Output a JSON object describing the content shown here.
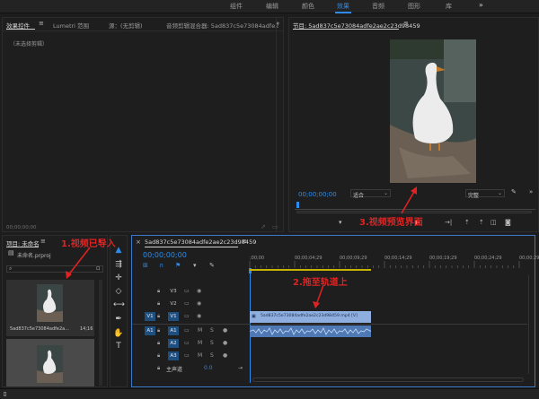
{
  "workspace_tabs": [
    {
      "label": "组件",
      "active": false
    },
    {
      "label": "编辑",
      "active": false
    },
    {
      "label": "颜色",
      "active": false
    },
    {
      "label": "效果",
      "active": true
    },
    {
      "label": "音频",
      "active": false
    },
    {
      "label": "图形",
      "active": false
    },
    {
      "label": "库",
      "active": false
    }
  ],
  "workspace_more": "»",
  "effects_panel": {
    "tabs": [
      "效果控件",
      "Lumetri 范围",
      "源：(无剪辑)",
      "音频剪辑混合器: 5ad837c5e73084adfe2"
    ],
    "more": "»",
    "no_clip": "（未选择剪辑）",
    "timecode": "00;00;00;00"
  },
  "program_monitor": {
    "title": "节目: 5ad837c5e73084adfe2ae2c23d98459",
    "timecode": "00;00;00;00",
    "fit": "适合",
    "quality": "完整"
  },
  "project_panel": {
    "title": "项目: 未命名",
    "more": "»",
    "project_file": "未命名.prproj",
    "clip_name": "5ad837c5e73084adfe2a...",
    "clip_duration": "14;16"
  },
  "timeline": {
    "sequence_name": "5ad837c5e73084adfe2ae2c23d98459",
    "timecode": "00;00;00;00",
    "ruler_labels": [
      ";00;00",
      "00;00;04;29",
      "00;00;09;29",
      "00;00;14;29",
      "00;00;19;29",
      "00;00;24;29",
      "00;00;29;29"
    ],
    "video_tracks": [
      "V3",
      "V2",
      "V1"
    ],
    "audio_tracks": [
      "A1",
      "A2",
      "A3"
    ],
    "track_v1_label": "V1",
    "track_a1_label": "A1",
    "master_label": "主声道",
    "master_value": "0.0",
    "clip_label": "5ad837c5e73084adfe2ae2c23d98459.mp4 [V]"
  },
  "annotations": {
    "step1": "1.视频已导入",
    "step2": "2.拖至轨道上",
    "step3": "3.视频预览界面"
  },
  "colors": {
    "accent": "#2d8ceb",
    "annotation": "#e22222",
    "clip_video": "#8eaee0",
    "clip_audio": "#4f79b4",
    "track_on": "#1f4f7e"
  }
}
